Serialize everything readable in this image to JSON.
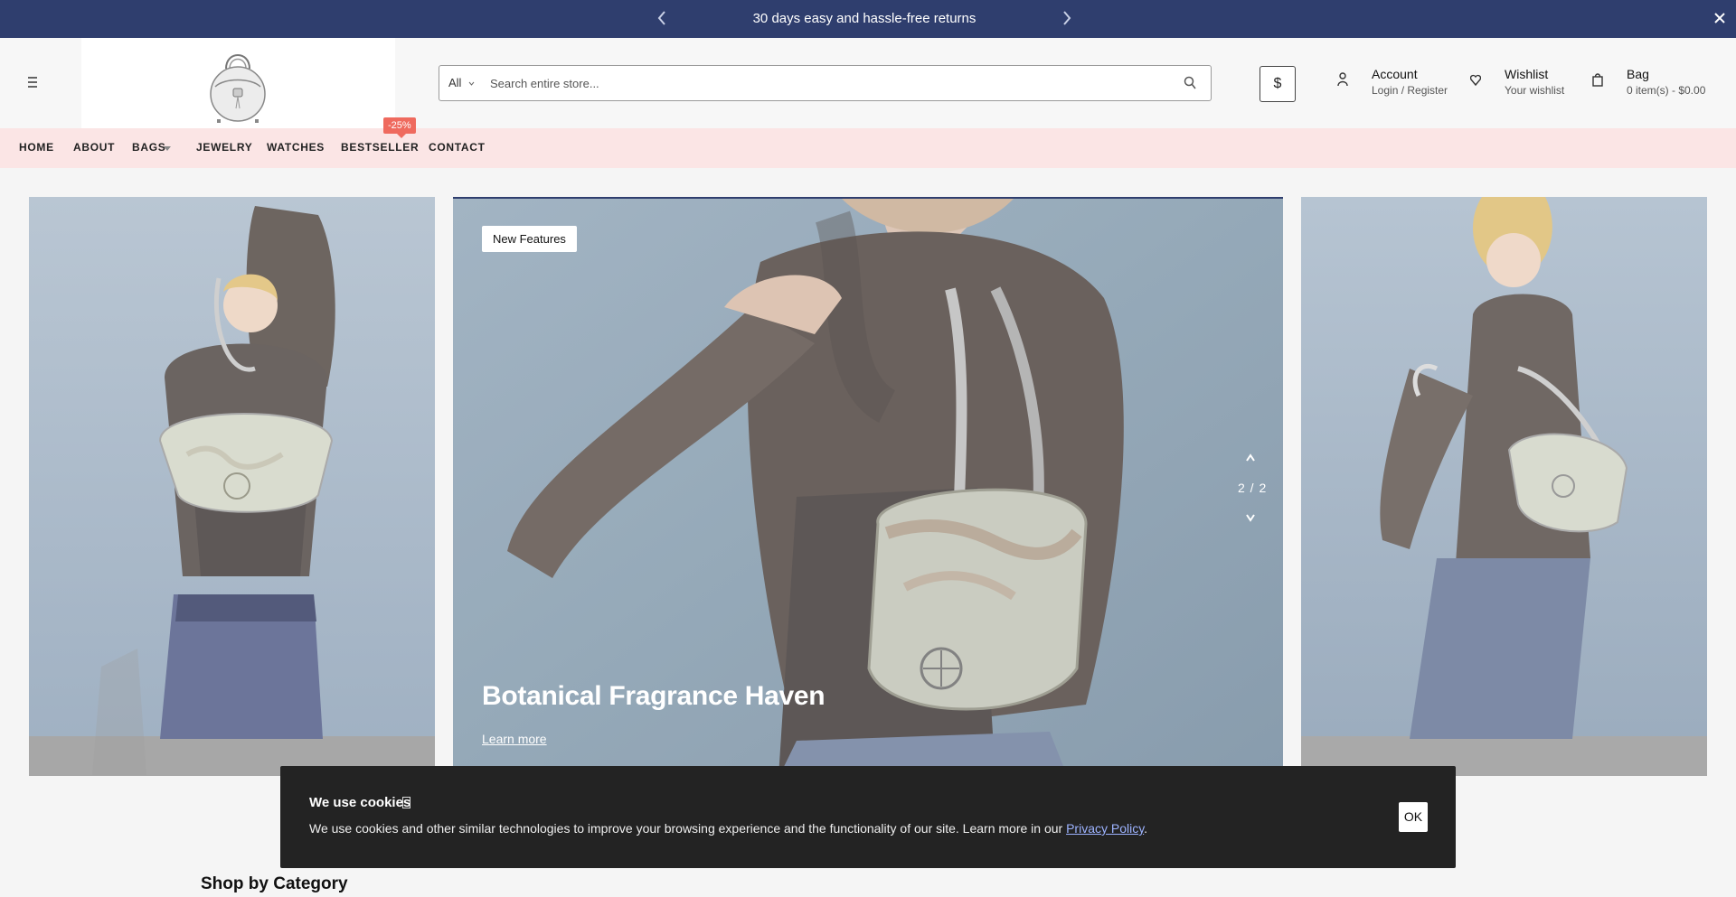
{
  "announcement": {
    "message": "30 days easy and hassle-free returns",
    "prev_icon": "chevron-left-icon",
    "next_icon": "chevron-right-icon",
    "close_icon": "close-icon"
  },
  "header": {
    "menu_icon": "hamburger-icon",
    "logo": "handbag-logo",
    "search": {
      "category": "All",
      "placeholder": "Search entire store...",
      "button_icon": "search-icon"
    },
    "currency": "$",
    "account": {
      "title": "Account",
      "subtitle": "Login / Register",
      "icon": "user-icon"
    },
    "wishlist": {
      "title": "Wishlist",
      "subtitle": "Your wishlist",
      "icon": "heart-icon"
    },
    "bag": {
      "title": "Bag",
      "subtitle": "0 item(s) - $0.00",
      "icon": "bag-icon"
    }
  },
  "nav": {
    "items": [
      "HOME",
      "ABOUT",
      "BAGS",
      "JEWELRY",
      "WATCHES",
      "BESTSELLER",
      "CONTACT"
    ],
    "sale_badge": "-25%"
  },
  "hero": {
    "badge": "New Features",
    "title": "Botanical Fragrance Haven",
    "link": "Learn more",
    "counter": "2 / 2"
  },
  "cookie": {
    "title": "We use cookies",
    "text": "We use cookies and other similar technologies to improve your browsing experience and the functionality of our site. Learn more in our ",
    "link": "Privacy Policy",
    "end": ".",
    "ok": "OK"
  },
  "section": {
    "heading": "Shop by Category"
  },
  "colors": {
    "topbar": "#2f3e6e",
    "nav_bg": "#fbe5e5",
    "sale": "#ef6a5e",
    "cookie_bg": "#232323"
  }
}
